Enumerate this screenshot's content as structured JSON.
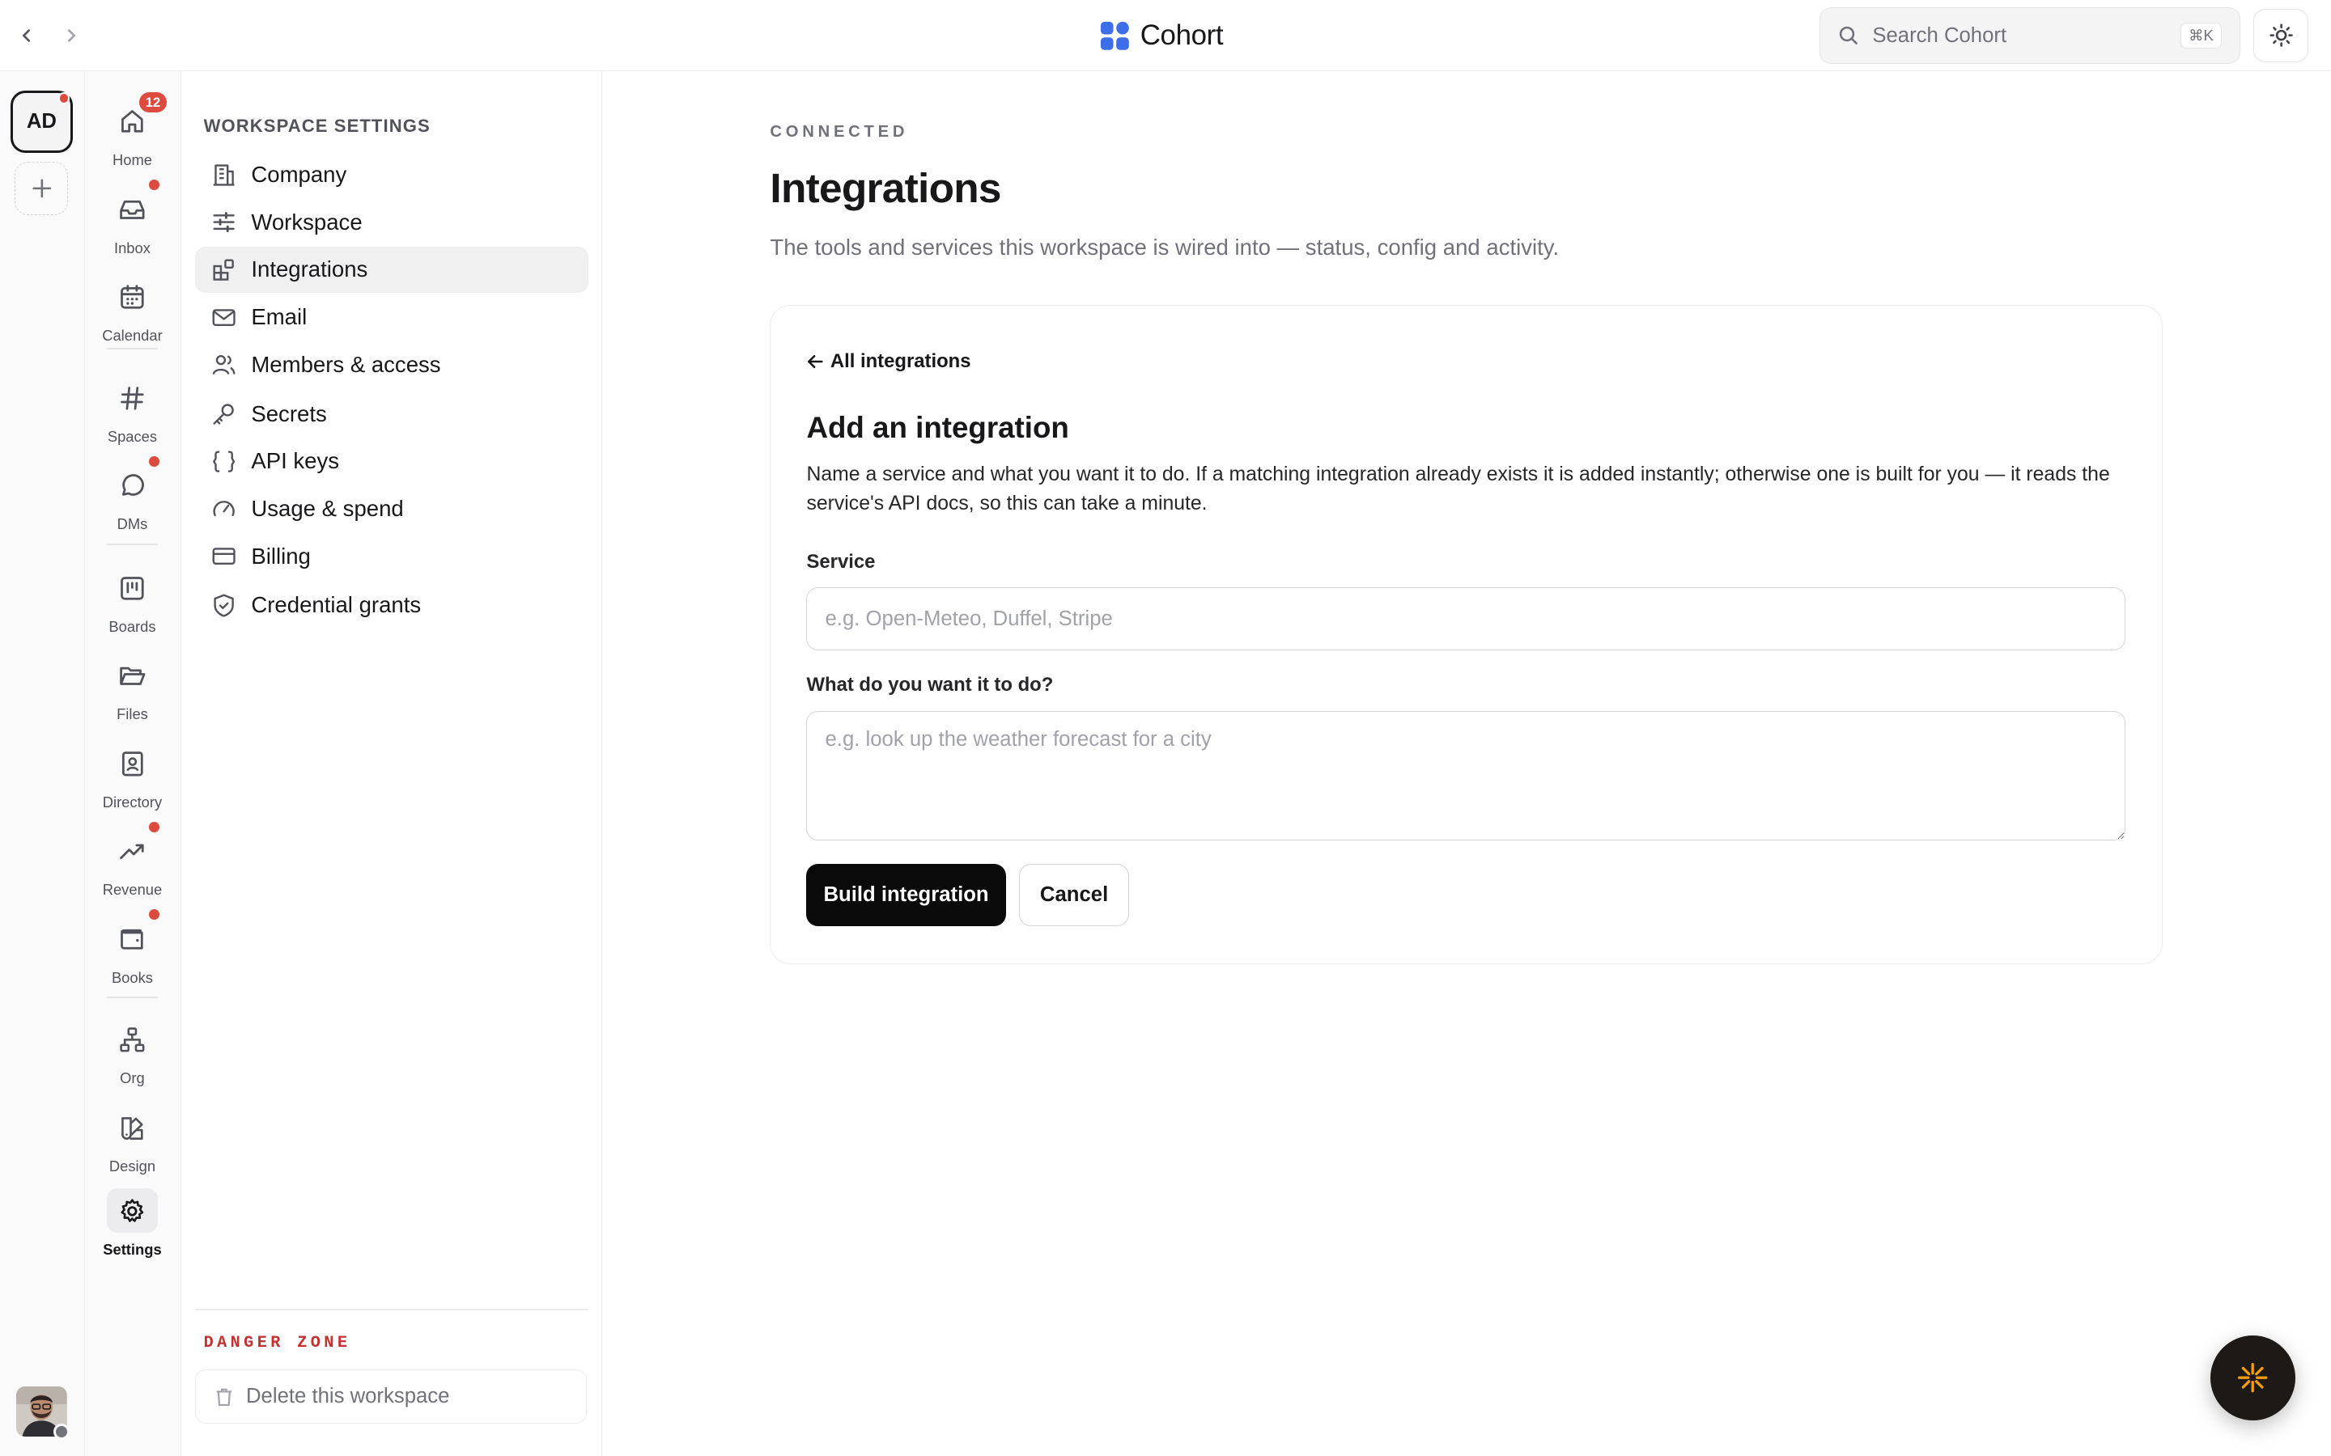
{
  "app": {
    "name": "Cohort",
    "brand_color": "#3b6ee8"
  },
  "topbar": {
    "search_placeholder": "Search Cohort",
    "search_shortcut": "⌘K"
  },
  "workspace": {
    "initials": "AD"
  },
  "nav": {
    "home": {
      "label": "Home",
      "badge": "12"
    },
    "inbox": {
      "label": "Inbox"
    },
    "calendar": {
      "label": "Calendar"
    },
    "spaces": {
      "label": "Spaces"
    },
    "dms": {
      "label": "DMs"
    },
    "boards": {
      "label": "Boards"
    },
    "files": {
      "label": "Files"
    },
    "directory": {
      "label": "Directory"
    },
    "revenue": {
      "label": "Revenue"
    },
    "books": {
      "label": "Books"
    },
    "org": {
      "label": "Org"
    },
    "design": {
      "label": "Design"
    },
    "settings": {
      "label": "Settings"
    }
  },
  "settings_sidebar": {
    "title": "WORKSPACE SETTINGS",
    "items": [
      {
        "label": "Company",
        "icon": "building-icon"
      },
      {
        "label": "Workspace",
        "icon": "sliders-icon"
      },
      {
        "label": "Integrations",
        "icon": "blocks-icon",
        "active": true
      },
      {
        "label": "Email",
        "icon": "mail-icon"
      },
      {
        "label": "Members & access",
        "icon": "users-icon"
      },
      {
        "label": "Secrets",
        "icon": "key-icon"
      },
      {
        "label": "API keys",
        "icon": "braces-icon"
      },
      {
        "label": "Usage & spend",
        "icon": "gauge-icon"
      },
      {
        "label": "Billing",
        "icon": "credit-card-icon"
      },
      {
        "label": "Credential grants",
        "icon": "shield-check-icon"
      }
    ],
    "danger_title": "DANGER ZONE",
    "danger_button": "Delete this workspace"
  },
  "main": {
    "eyebrow": "CONNECTED",
    "title": "Integrations",
    "subtitle": "The tools and services this workspace is wired into — status, config and activity.",
    "back_link": "All integrations",
    "card_title": "Add an integration",
    "card_description": "Name a service and what you want it to do. If a matching integration already exists it is added instantly; otherwise one is built for you — it reads the service's API docs, so this can take a minute.",
    "service_label": "Service",
    "service_placeholder": "e.g. Open-Meteo, Duffel, Stripe",
    "task_label": "What do you want it to do?",
    "task_placeholder": "e.g. look up the weather forecast for a city",
    "primary_button": "Build integration",
    "secondary_button": "Cancel"
  }
}
